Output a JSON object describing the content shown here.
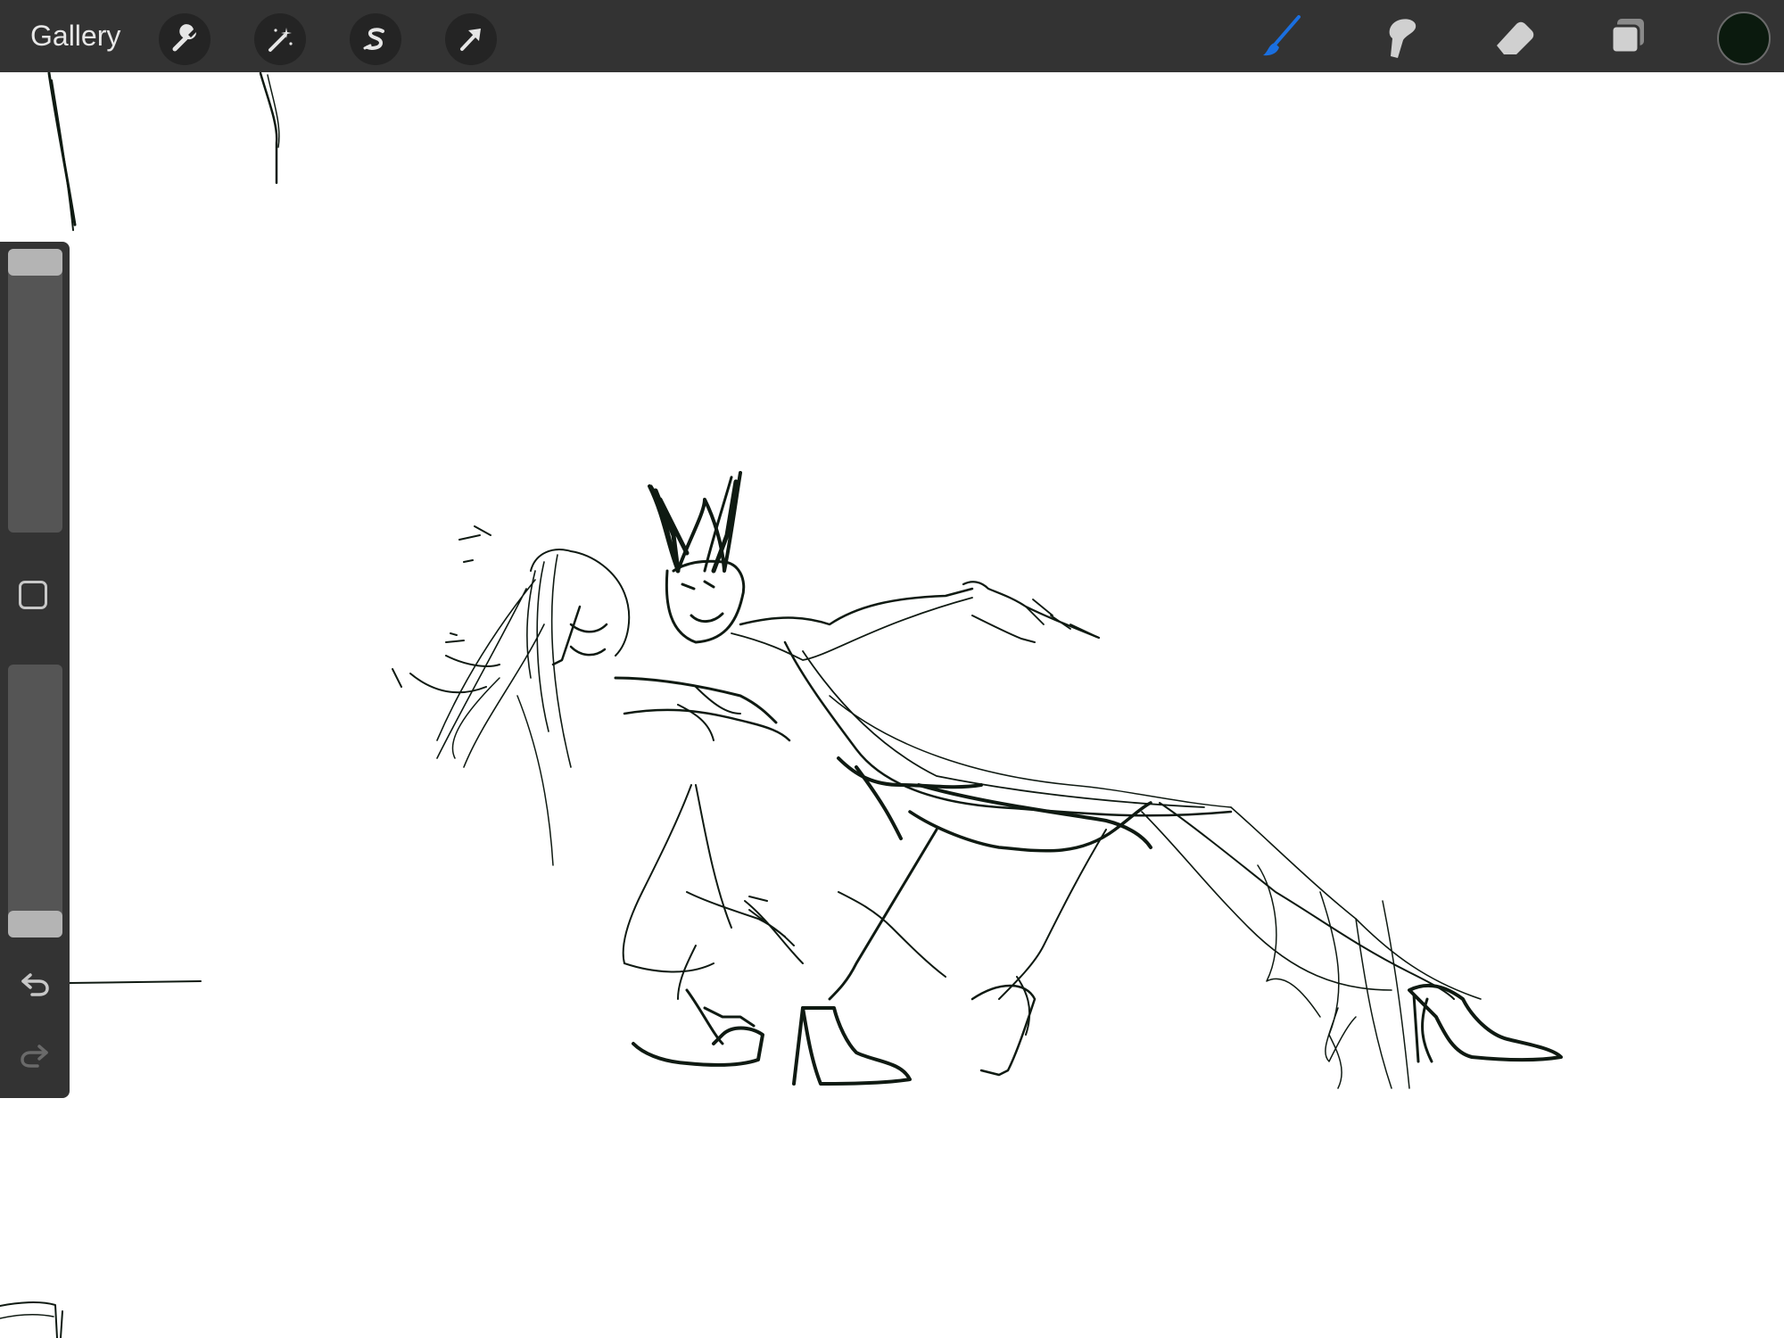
{
  "toolbar": {
    "gallery_label": "Gallery",
    "left_tools": [
      "wrench-icon",
      "magic-wand-icon",
      "selection-icon",
      "transform-arrow-icon"
    ],
    "right_tools": [
      "brush-icon",
      "smudge-icon",
      "eraser-icon",
      "layers-icon"
    ],
    "active_tool": "brush",
    "active_tool_color": "#1a6fe0",
    "current_color": "#0b1a0e"
  },
  "sidebar": {
    "brush_size_level": 1.0,
    "opacity_level": 0.0,
    "icons": [
      "modify-button-icon",
      "undo-icon",
      "redo-icon"
    ]
  },
  "canvas": {
    "background": "#ffffff",
    "stroke_color": "#0f1a12"
  }
}
